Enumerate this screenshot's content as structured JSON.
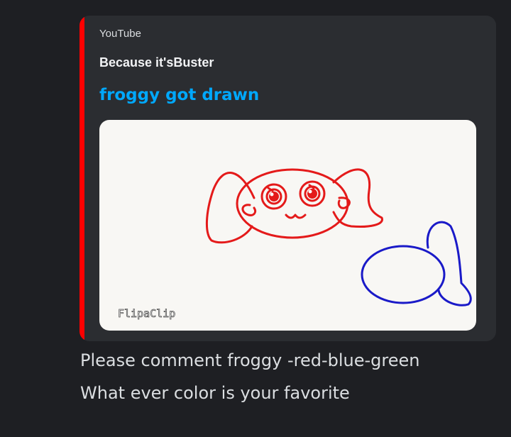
{
  "message": {
    "top_partial_text": "",
    "lines": [
      "Please comment froggy -red-blue-green",
      "What ever color is your favorite"
    ]
  },
  "embed": {
    "provider": "YouTube",
    "author": "Because it'sBuster",
    "title": "froggy got drawn",
    "accent_color": "#ff0000",
    "title_color": "#00a8fc",
    "thumbnail": {
      "watermark": "FlipaClip",
      "drawing_colors": [
        "#e41a1a",
        "#1a1ac8"
      ]
    }
  }
}
